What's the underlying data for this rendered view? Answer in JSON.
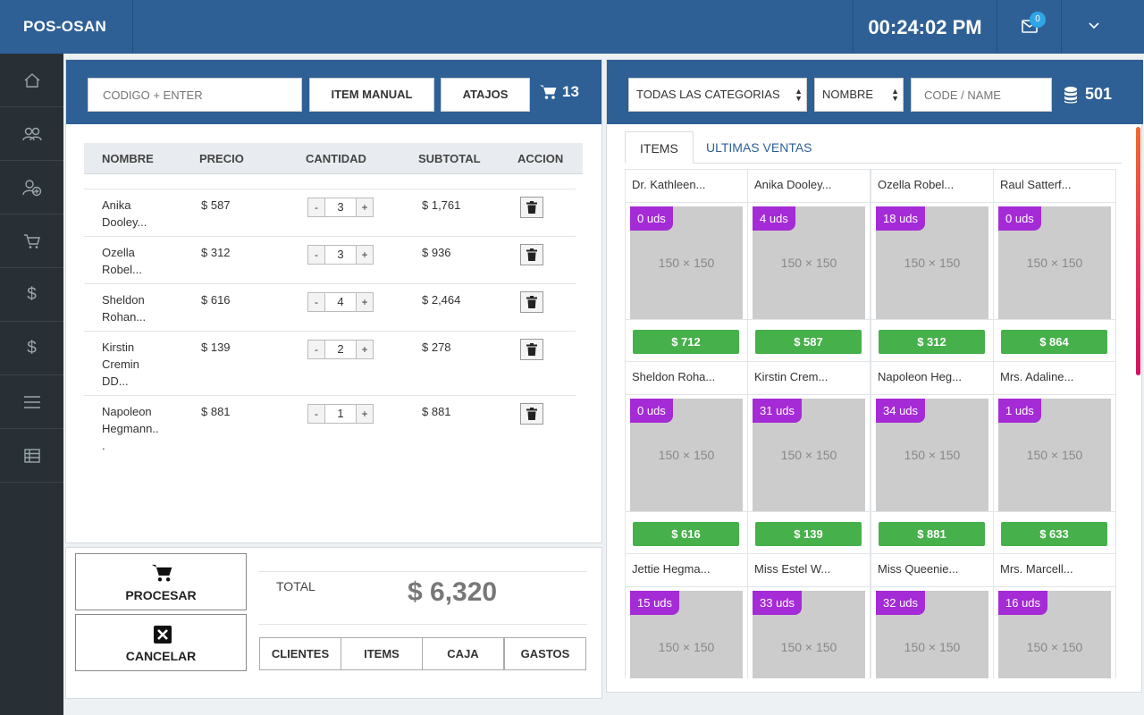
{
  "app": {
    "brand": "POS-OSAN",
    "clock": "00:24:02 PM",
    "mail_badge": "0"
  },
  "sidebar": {
    "items": [
      "home-icon",
      "users-icon",
      "add-user-icon",
      "cart-icon",
      "dollar-icon",
      "dollar-icon",
      "menu-icon",
      "table-icon"
    ]
  },
  "left": {
    "code_placeholder": "CODIGO + ENTER",
    "item_manual_label": "ITEM MANUAL",
    "atajos_label": "ATAJOS",
    "cart_count": "13",
    "columns": [
      "NOMBRE",
      "PRECIO",
      "CANTIDAD",
      "SUBTOTAL",
      "ACCION"
    ],
    "rows": [
      {
        "name": [
          "Anika",
          "Dooley..."
        ],
        "price": "$ 587",
        "qty": "3",
        "subtotal": "$ 1,761"
      },
      {
        "name": [
          "Ozella",
          "Robel..."
        ],
        "price": "$ 312",
        "qty": "3",
        "subtotal": "$ 936"
      },
      {
        "name": [
          "Sheldon",
          "Rohan..."
        ],
        "price": "$ 616",
        "qty": "4",
        "subtotal": "$ 2,464"
      },
      {
        "name": [
          "Kirstin",
          "Cremin",
          "DD..."
        ],
        "price": "$ 139",
        "qty": "2",
        "subtotal": "$ 278"
      },
      {
        "name": [
          "Napoleon",
          "Hegmann..",
          "."
        ],
        "price": "$ 881",
        "qty": "1",
        "subtotal": "$ 881"
      }
    ],
    "minus": "-",
    "plus": "+",
    "procesar_label": "PROCESAR",
    "cancelar_label": "CANCELAR",
    "total_label": "TOTAL",
    "total_value": "$ 6,320",
    "footer_buttons": [
      "CLIENTES",
      "ITEMS",
      "CAJA",
      "GASTOS"
    ]
  },
  "right": {
    "category_select": "TODAS LAS CATEGORIAS",
    "sort_select": "NOMBRE",
    "search_placeholder": "CODE / NAME",
    "product_count": "501",
    "tabs": [
      "ITEMS",
      "ULTIMAS VENTAS"
    ],
    "products": [
      {
        "name": "Dr. Kathleen...",
        "stock": "0 uds",
        "img": "150 × 150",
        "price": "$ 712"
      },
      {
        "name": "Anika Dooley...",
        "stock": "4 uds",
        "img": "150 × 150",
        "price": "$ 587"
      },
      {
        "name": "Ozella Robel...",
        "stock": "18 uds",
        "img": "150 × 150",
        "price": "$ 312"
      },
      {
        "name": "Raul Satterf...",
        "stock": "0 uds",
        "img": "150 × 150",
        "price": "$ 864"
      },
      {
        "name": "Sheldon Roha...",
        "stock": "0 uds",
        "img": "150 × 150",
        "price": "$ 616"
      },
      {
        "name": "Kirstin Crem...",
        "stock": "31 uds",
        "img": "150 × 150",
        "price": "$ 139"
      },
      {
        "name": "Napoleon Heg...",
        "stock": "34 uds",
        "img": "150 × 150",
        "price": "$ 881"
      },
      {
        "name": "Mrs. Adaline...",
        "stock": "1 uds",
        "img": "150 × 150",
        "price": "$ 633"
      },
      {
        "name": "Jettie Hegma...",
        "stock": "15 uds",
        "img": "150 × 150",
        "price": ""
      },
      {
        "name": "Miss Estel W...",
        "stock": "33 uds",
        "img": "150 × 150",
        "price": ""
      },
      {
        "name": "Miss Queenie...",
        "stock": "32 uds",
        "img": "150 × 150",
        "price": ""
      },
      {
        "name": "Mrs. Marcell...",
        "stock": "16 uds",
        "img": "150 × 150",
        "price": ""
      }
    ]
  },
  "colors": {
    "header": "#2e6096",
    "sidebar": "#283035",
    "stock_badge": "#a52bd6",
    "price_button": "#46b04a"
  }
}
